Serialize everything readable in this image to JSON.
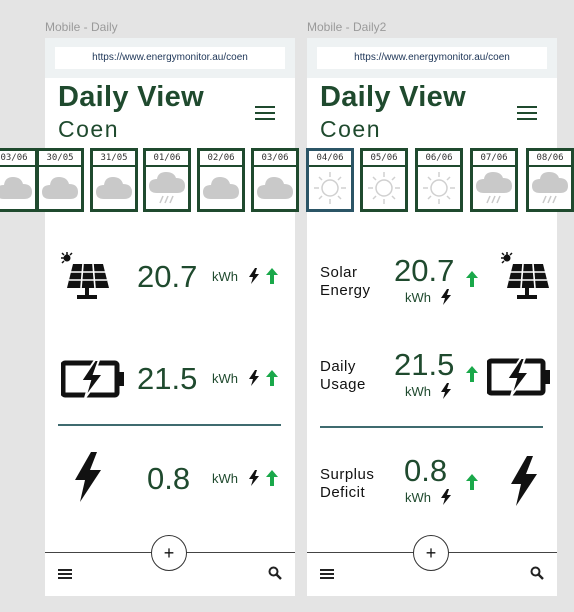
{
  "frames": [
    {
      "label": "Mobile - Daily",
      "url": "https://www.energymonitor.au/coen",
      "title": "Daily View",
      "subtitle": "Coen",
      "metrics": [
        {
          "value": "20.7",
          "unit": "kWh",
          "icon": "solar-panel-icon"
        },
        {
          "value": "21.5",
          "unit": "kWh",
          "icon": "battery-icon"
        },
        {
          "value": "0.8",
          "unit": "kWh",
          "icon": "lightning-icon"
        }
      ],
      "fab": "+"
    },
    {
      "label": "Mobile - Daily2",
      "url": "https://www.energymonitor.au/coen",
      "title": "Daily View",
      "subtitle": "Coen",
      "metrics": [
        {
          "label_line1": "Solar",
          "label_line2": "Energy",
          "value": "20.7",
          "unit": "kWh",
          "icon": "solar-panel-icon"
        },
        {
          "label_line1": "Daily",
          "label_line2": "Usage",
          "value": "21.5",
          "unit": "kWh",
          "icon": "battery-icon"
        },
        {
          "label_line1": "Surplus",
          "label_line2": "Deficit",
          "value": "0.8",
          "unit": "kWh",
          "icon": "lightning-icon"
        }
      ],
      "fab": "+"
    }
  ],
  "days": [
    {
      "date": "03/06",
      "weather": "cloud"
    },
    {
      "date": "30/05",
      "weather": "cloud"
    },
    {
      "date": "31/05",
      "weather": "cloud"
    },
    {
      "date": "01/06",
      "weather": "rain"
    },
    {
      "date": "02/06",
      "weather": "cloud"
    },
    {
      "date": "03/06",
      "weather": "cloud"
    },
    {
      "date": "04/06",
      "weather": "sun",
      "selected": true
    },
    {
      "date": "05/06",
      "weather": "sun"
    },
    {
      "date": "06/06",
      "weather": "sun"
    },
    {
      "date": "07/06",
      "weather": "rain"
    },
    {
      "date": "08/06",
      "weather": "rain"
    }
  ],
  "colors": {
    "accent": "#1f4a2e",
    "trend_up": "#1aa84a",
    "divider": "#3f6b6f"
  }
}
